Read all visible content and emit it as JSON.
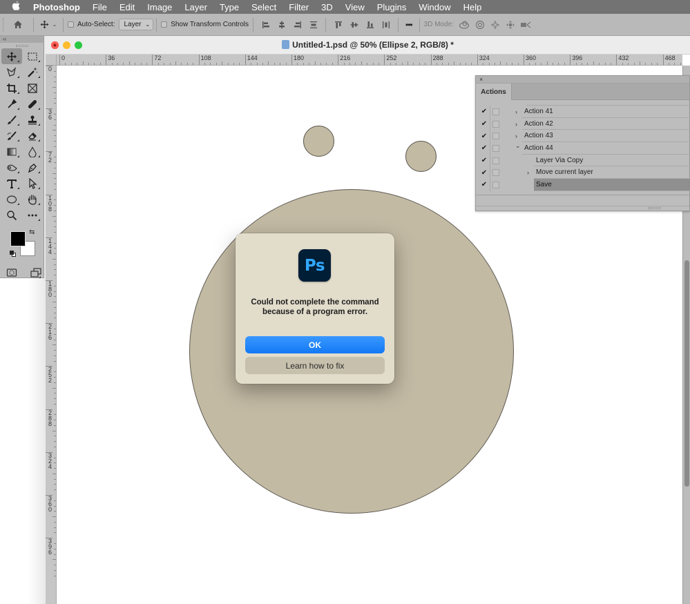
{
  "menubar": {
    "apple_icon": "apple-icon",
    "app_name": "Photoshop",
    "items": [
      "File",
      "Edit",
      "Image",
      "Layer",
      "Type",
      "Select",
      "Filter",
      "3D",
      "View",
      "Plugins",
      "Window",
      "Help"
    ]
  },
  "options_bar": {
    "auto_select_label": "Auto-Select:",
    "auto_select_checked": false,
    "auto_select_value": "Layer",
    "show_transform_label": "Show Transform Controls",
    "show_transform_checked": false,
    "more_label": "•••",
    "mode_3d_label": "3D Mode:"
  },
  "toolbox": {
    "collapse_label": "‹‹",
    "tools": [
      "move-tool",
      "rectangular-marquee-tool",
      "lasso-tool",
      "magic-wand-tool",
      "crop-tool",
      "frame-tool",
      "eyedropper-tool",
      "healing-brush-tool",
      "brush-tool",
      "clone-stamp-tool",
      "history-brush-tool",
      "eraser-tool",
      "gradient-tool",
      "blur-tool",
      "dodge-tool",
      "pen-tool",
      "type-tool",
      "path-selection-tool",
      "ellipse-tool",
      "hand-tool",
      "zoom-tool",
      "edit-toolbar"
    ],
    "foreground_color": "#000000",
    "background_color": "#ffffff"
  },
  "document": {
    "title": "Untitled-1.psd @ 50% (Ellipse 2, RGB/8) *",
    "hruler_labels": [
      "0",
      "36",
      "72",
      "108",
      "144",
      "180",
      "216",
      "252",
      "288",
      "324",
      "360",
      "396",
      "432",
      "468"
    ],
    "vruler_labels": [
      "0",
      "36",
      "72",
      "108",
      "144",
      "180",
      "216",
      "252",
      "288",
      "324",
      "360",
      "396"
    ],
    "shape_fill": "#c3baa4",
    "shape_stroke": "#5e5a52"
  },
  "actions_panel": {
    "close_label": "×",
    "tab_label": "Actions",
    "rows": [
      {
        "label": "Action 41",
        "checked": true,
        "twisty": "collapsed",
        "level": 1,
        "selected": false
      },
      {
        "label": "Action 42",
        "checked": true,
        "twisty": "collapsed",
        "level": 1,
        "selected": false
      },
      {
        "label": "Action 43",
        "checked": true,
        "twisty": "collapsed",
        "level": 1,
        "selected": false
      },
      {
        "label": "Action 44",
        "checked": true,
        "twisty": "expanded",
        "level": 1,
        "selected": false
      },
      {
        "label": "Layer Via Copy",
        "checked": true,
        "twisty": "none",
        "level": 2,
        "selected": false
      },
      {
        "label": "Move current layer",
        "checked": true,
        "twisty": "collapsed",
        "level": 2,
        "selected": false
      },
      {
        "label": "Save",
        "checked": true,
        "twisty": "none",
        "level": 2,
        "selected": true
      }
    ]
  },
  "dialog": {
    "icon_label": "Ps",
    "message": "Could not complete the command because of a program error.",
    "ok_label": "OK",
    "learn_label": "Learn how to fix",
    "accent_color": "#1a85ff"
  }
}
